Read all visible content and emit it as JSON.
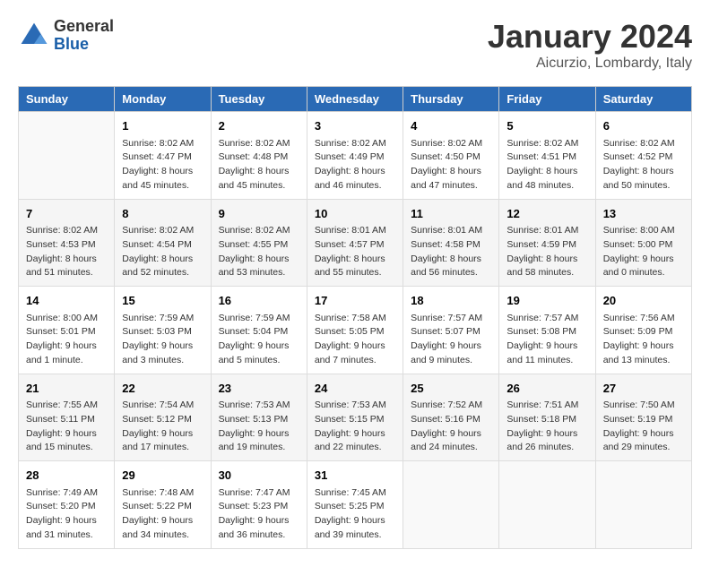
{
  "header": {
    "logo_general": "General",
    "logo_blue": "Blue",
    "month": "January 2024",
    "location": "Aicurzio, Lombardy, Italy"
  },
  "weekdays": [
    "Sunday",
    "Monday",
    "Tuesday",
    "Wednesday",
    "Thursday",
    "Friday",
    "Saturday"
  ],
  "weeks": [
    [
      {
        "day": "",
        "sunrise": "",
        "sunset": "",
        "daylight": ""
      },
      {
        "day": "1",
        "sunrise": "Sunrise: 8:02 AM",
        "sunset": "Sunset: 4:47 PM",
        "daylight": "Daylight: 8 hours and 45 minutes."
      },
      {
        "day": "2",
        "sunrise": "Sunrise: 8:02 AM",
        "sunset": "Sunset: 4:48 PM",
        "daylight": "Daylight: 8 hours and 45 minutes."
      },
      {
        "day": "3",
        "sunrise": "Sunrise: 8:02 AM",
        "sunset": "Sunset: 4:49 PM",
        "daylight": "Daylight: 8 hours and 46 minutes."
      },
      {
        "day": "4",
        "sunrise": "Sunrise: 8:02 AM",
        "sunset": "Sunset: 4:50 PM",
        "daylight": "Daylight: 8 hours and 47 minutes."
      },
      {
        "day": "5",
        "sunrise": "Sunrise: 8:02 AM",
        "sunset": "Sunset: 4:51 PM",
        "daylight": "Daylight: 8 hours and 48 minutes."
      },
      {
        "day": "6",
        "sunrise": "Sunrise: 8:02 AM",
        "sunset": "Sunset: 4:52 PM",
        "daylight": "Daylight: 8 hours and 50 minutes."
      }
    ],
    [
      {
        "day": "7",
        "sunrise": "Sunrise: 8:02 AM",
        "sunset": "Sunset: 4:53 PM",
        "daylight": "Daylight: 8 hours and 51 minutes."
      },
      {
        "day": "8",
        "sunrise": "Sunrise: 8:02 AM",
        "sunset": "Sunset: 4:54 PM",
        "daylight": "Daylight: 8 hours and 52 minutes."
      },
      {
        "day": "9",
        "sunrise": "Sunrise: 8:02 AM",
        "sunset": "Sunset: 4:55 PM",
        "daylight": "Daylight: 8 hours and 53 minutes."
      },
      {
        "day": "10",
        "sunrise": "Sunrise: 8:01 AM",
        "sunset": "Sunset: 4:57 PM",
        "daylight": "Daylight: 8 hours and 55 minutes."
      },
      {
        "day": "11",
        "sunrise": "Sunrise: 8:01 AM",
        "sunset": "Sunset: 4:58 PM",
        "daylight": "Daylight: 8 hours and 56 minutes."
      },
      {
        "day": "12",
        "sunrise": "Sunrise: 8:01 AM",
        "sunset": "Sunset: 4:59 PM",
        "daylight": "Daylight: 8 hours and 58 minutes."
      },
      {
        "day": "13",
        "sunrise": "Sunrise: 8:00 AM",
        "sunset": "Sunset: 5:00 PM",
        "daylight": "Daylight: 9 hours and 0 minutes."
      }
    ],
    [
      {
        "day": "14",
        "sunrise": "Sunrise: 8:00 AM",
        "sunset": "Sunset: 5:01 PM",
        "daylight": "Daylight: 9 hours and 1 minute."
      },
      {
        "day": "15",
        "sunrise": "Sunrise: 7:59 AM",
        "sunset": "Sunset: 5:03 PM",
        "daylight": "Daylight: 9 hours and 3 minutes."
      },
      {
        "day": "16",
        "sunrise": "Sunrise: 7:59 AM",
        "sunset": "Sunset: 5:04 PM",
        "daylight": "Daylight: 9 hours and 5 minutes."
      },
      {
        "day": "17",
        "sunrise": "Sunrise: 7:58 AM",
        "sunset": "Sunset: 5:05 PM",
        "daylight": "Daylight: 9 hours and 7 minutes."
      },
      {
        "day": "18",
        "sunrise": "Sunrise: 7:57 AM",
        "sunset": "Sunset: 5:07 PM",
        "daylight": "Daylight: 9 hours and 9 minutes."
      },
      {
        "day": "19",
        "sunrise": "Sunrise: 7:57 AM",
        "sunset": "Sunset: 5:08 PM",
        "daylight": "Daylight: 9 hours and 11 minutes."
      },
      {
        "day": "20",
        "sunrise": "Sunrise: 7:56 AM",
        "sunset": "Sunset: 5:09 PM",
        "daylight": "Daylight: 9 hours and 13 minutes."
      }
    ],
    [
      {
        "day": "21",
        "sunrise": "Sunrise: 7:55 AM",
        "sunset": "Sunset: 5:11 PM",
        "daylight": "Daylight: 9 hours and 15 minutes."
      },
      {
        "day": "22",
        "sunrise": "Sunrise: 7:54 AM",
        "sunset": "Sunset: 5:12 PM",
        "daylight": "Daylight: 9 hours and 17 minutes."
      },
      {
        "day": "23",
        "sunrise": "Sunrise: 7:53 AM",
        "sunset": "Sunset: 5:13 PM",
        "daylight": "Daylight: 9 hours and 19 minutes."
      },
      {
        "day": "24",
        "sunrise": "Sunrise: 7:53 AM",
        "sunset": "Sunset: 5:15 PM",
        "daylight": "Daylight: 9 hours and 22 minutes."
      },
      {
        "day": "25",
        "sunrise": "Sunrise: 7:52 AM",
        "sunset": "Sunset: 5:16 PM",
        "daylight": "Daylight: 9 hours and 24 minutes."
      },
      {
        "day": "26",
        "sunrise": "Sunrise: 7:51 AM",
        "sunset": "Sunset: 5:18 PM",
        "daylight": "Daylight: 9 hours and 26 minutes."
      },
      {
        "day": "27",
        "sunrise": "Sunrise: 7:50 AM",
        "sunset": "Sunset: 5:19 PM",
        "daylight": "Daylight: 9 hours and 29 minutes."
      }
    ],
    [
      {
        "day": "28",
        "sunrise": "Sunrise: 7:49 AM",
        "sunset": "Sunset: 5:20 PM",
        "daylight": "Daylight: 9 hours and 31 minutes."
      },
      {
        "day": "29",
        "sunrise": "Sunrise: 7:48 AM",
        "sunset": "Sunset: 5:22 PM",
        "daylight": "Daylight: 9 hours and 34 minutes."
      },
      {
        "day": "30",
        "sunrise": "Sunrise: 7:47 AM",
        "sunset": "Sunset: 5:23 PM",
        "daylight": "Daylight: 9 hours and 36 minutes."
      },
      {
        "day": "31",
        "sunrise": "Sunrise: 7:45 AM",
        "sunset": "Sunset: 5:25 PM",
        "daylight": "Daylight: 9 hours and 39 minutes."
      },
      {
        "day": "",
        "sunrise": "",
        "sunset": "",
        "daylight": ""
      },
      {
        "day": "",
        "sunrise": "",
        "sunset": "",
        "daylight": ""
      },
      {
        "day": "",
        "sunrise": "",
        "sunset": "",
        "daylight": ""
      }
    ]
  ]
}
